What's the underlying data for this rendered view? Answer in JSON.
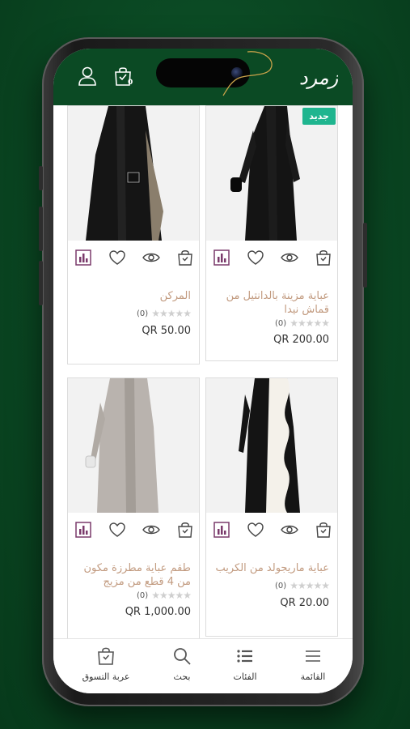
{
  "header": {
    "cart_count": "0",
    "logo_text": "زمرد"
  },
  "products": [
    {
      "id": "p1",
      "title": "عباية مزينة بالدانتيل من قماش نيدا",
      "rating_count": "(0)",
      "price": "QR 200.00",
      "badge": "جديد"
    },
    {
      "id": "p2",
      "title": "المركن",
      "rating_count": "(0)",
      "price": "QR 50.00",
      "badge": ""
    },
    {
      "id": "p3",
      "title": "عباية ماريجولد من الكريب",
      "rating_count": "(0)",
      "price": "QR 20.00",
      "badge": ""
    },
    {
      "id": "p4",
      "title": "طقم عباية مطرزة مكون من 4 قطع من مزيج",
      "rating_count": "(0)",
      "price": "QR 1,000.00",
      "badge": ""
    }
  ],
  "bottom_nav": {
    "menu": "القائمة",
    "categories": "الفئات",
    "search": "بحث",
    "cart": "عربة التسوق"
  },
  "icons": {
    "compare": "bar-chart-icon",
    "wishlist": "heart-icon",
    "quick_view": "eye-icon",
    "add_to_cart": "shopping-bag-icon"
  },
  "colors": {
    "brand_green": "#0b4a24",
    "badge": "#1fb58f",
    "title": "#c29b80",
    "action_purple": "#7a3a6b"
  }
}
